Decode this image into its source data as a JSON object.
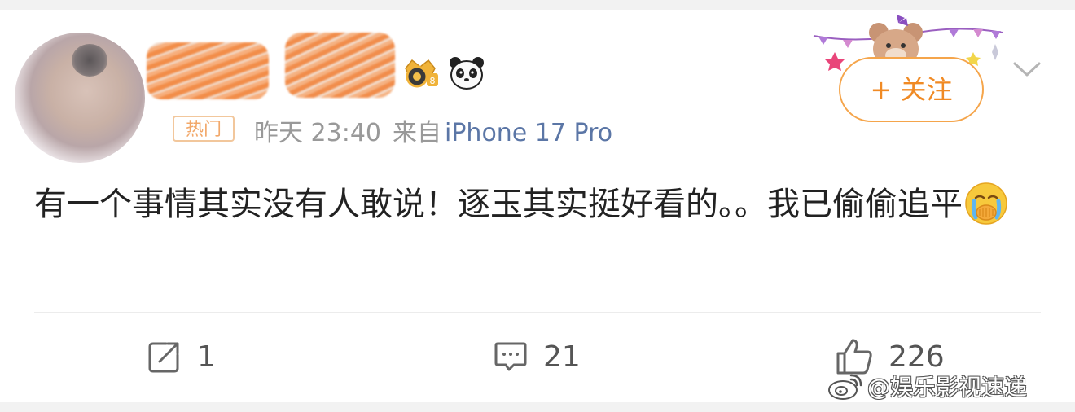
{
  "post": {
    "hot_badge": "热门",
    "time": "昨天 23:40",
    "source_prefix": "来自",
    "device": "iPhone 17 Pro",
    "follow_label": "+ 关注",
    "content": "有一个事情其实没有人敢说！逐玉其实挺好看的。。我已偷偷追平",
    "content_emoji": "crying-face-icon"
  },
  "actions": {
    "repost_count": "1",
    "comment_count": "21",
    "like_count": "226"
  },
  "watermark": {
    "text": "@娱乐影视速递"
  },
  "icons": [
    "vip-crown-icon",
    "panda-icon",
    "chevron-down-icon",
    "repost-icon",
    "comment-icon",
    "like-icon",
    "weibo-logo-icon"
  ],
  "colors": {
    "follow_accent": "#f08a24",
    "device_link": "#5b76a6",
    "hot_badge": "#f2a86a"
  }
}
